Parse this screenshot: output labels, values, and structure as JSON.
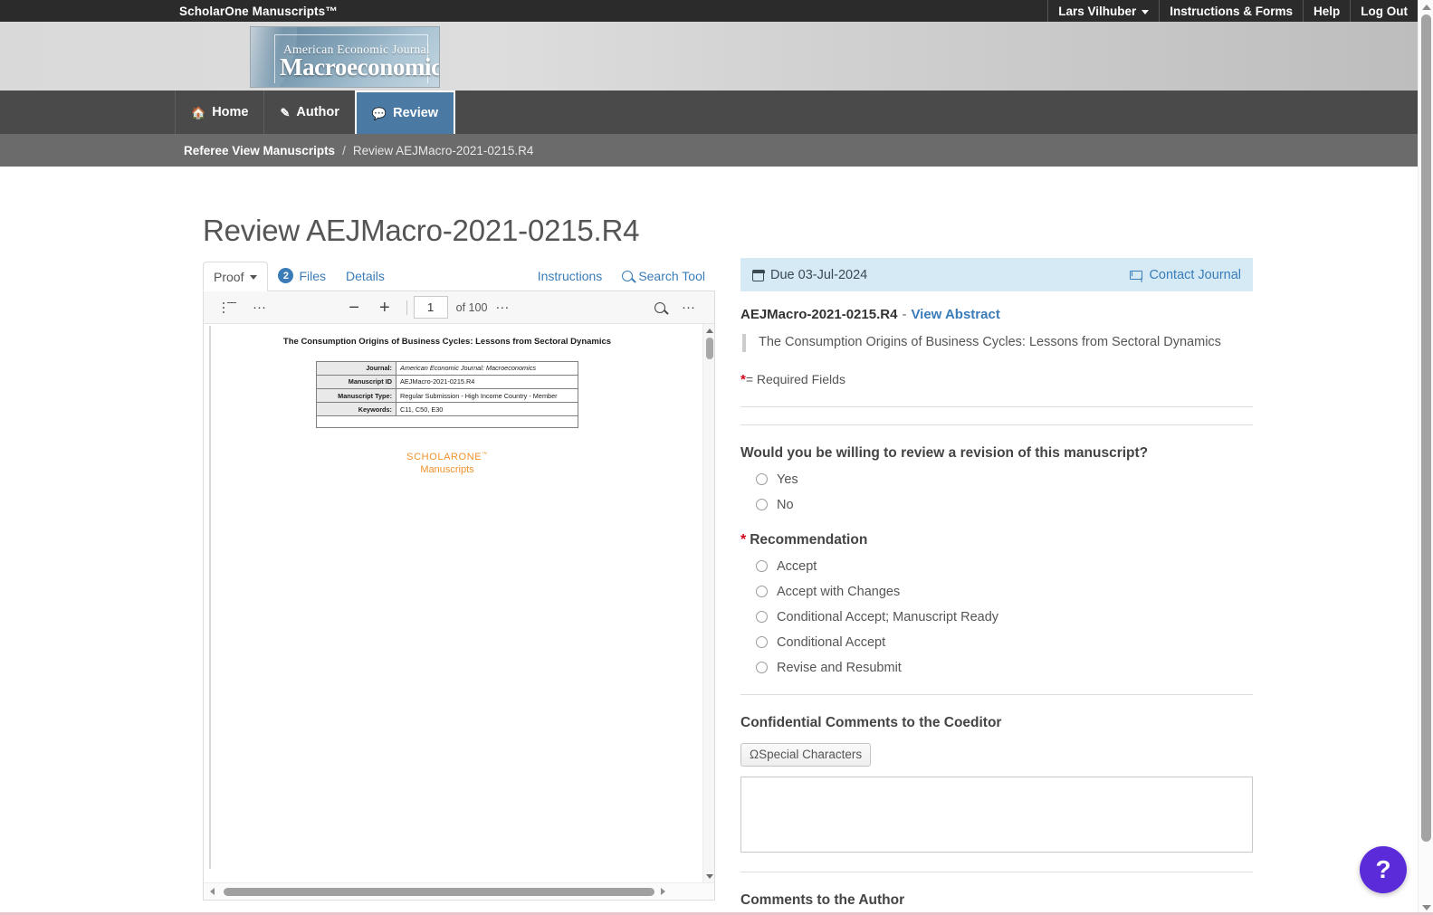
{
  "topbar": {
    "brand": "ScholarOne Manuscripts™",
    "user_menu": "Lars Vilhuber",
    "links": [
      "Instructions & Forms",
      "Help",
      "Log Out"
    ]
  },
  "journal_logo": {
    "line1": "American Economic Journal",
    "line2": "Macroeconomics"
  },
  "mainnav": {
    "items": [
      {
        "label": "Home",
        "icon": "home-icon",
        "active": false
      },
      {
        "label": "Author",
        "icon": "pencil-icon",
        "active": false
      },
      {
        "label": "Review",
        "icon": "comment-icon",
        "active": true
      }
    ]
  },
  "breadcrumb": {
    "parent": "Referee View Manuscripts",
    "separator": "/",
    "current": "Review AEJMacro-2021-0215.R4"
  },
  "page": {
    "title": "Review AEJMacro-2021-0215.R4"
  },
  "proof_tabs": {
    "proof_label": "Proof",
    "files_badge": "2",
    "files_label": "Files",
    "details_label": "Details",
    "instructions_label": "Instructions",
    "search_tool_label": "Search Tool"
  },
  "pdf_toolbar": {
    "zoom_out": "−",
    "zoom_in": "+",
    "page_value": "1",
    "page_total": "of 100",
    "more": "···"
  },
  "pdf_page": {
    "title": "The Consumption Origins of Business Cycles: Lessons from Sectoral Dynamics",
    "rows": [
      {
        "key": "Journal:",
        "value": "American Economic Journal: Macroeconomics",
        "italic": true
      },
      {
        "key": "Manuscript ID",
        "value": "AEJMacro-2021-0215.R4",
        "italic": false
      },
      {
        "key": "Manuscript Type:",
        "value": "Regular Submission - High Income Country - Member",
        "italic": false
      },
      {
        "key": "Keywords:",
        "value": "C11, C50, E30",
        "italic": false
      }
    ],
    "logo_top": "SCHOLARONE",
    "logo_top_tm": "™",
    "logo_bottom": "Manuscripts"
  },
  "review_form": {
    "due_label": "Due 03-Jul-2024",
    "contact_journal": "Contact Journal",
    "manuscript_id": "AEJMacro-2021-0215.R4",
    "dash": "-",
    "view_abstract": "View Abstract",
    "manuscript_title": "The Consumption Origins of Business Cycles: Lessons from Sectoral Dynamics",
    "required_star": "*",
    "required_note": "= Required Fields",
    "revision_question": "Would you be willing to review a revision of this manuscript?",
    "revision_options": [
      "Yes",
      "No"
    ],
    "recommendation_label": "Recommendation",
    "recommendation_options": [
      "Accept",
      "Accept with Changes",
      "Conditional Accept; Manuscript Ready",
      "Conditional Accept",
      "Revise and Resubmit"
    ],
    "confidential_label": "Confidential Comments to the Coeditor",
    "special_chars_button": "ΩSpecial Characters",
    "confidential_value": "",
    "comments_author_label": "Comments to the Author"
  },
  "help": {
    "glyph": "?"
  },
  "colors": {
    "accent_blue": "#3a7cb8",
    "active_tab": "#4a79a4",
    "due_bar": "#d6eaf5",
    "required_red": "#d0021b",
    "help_purple": "#5b2bd9",
    "pdf_logo_orange": "#f0932b"
  }
}
